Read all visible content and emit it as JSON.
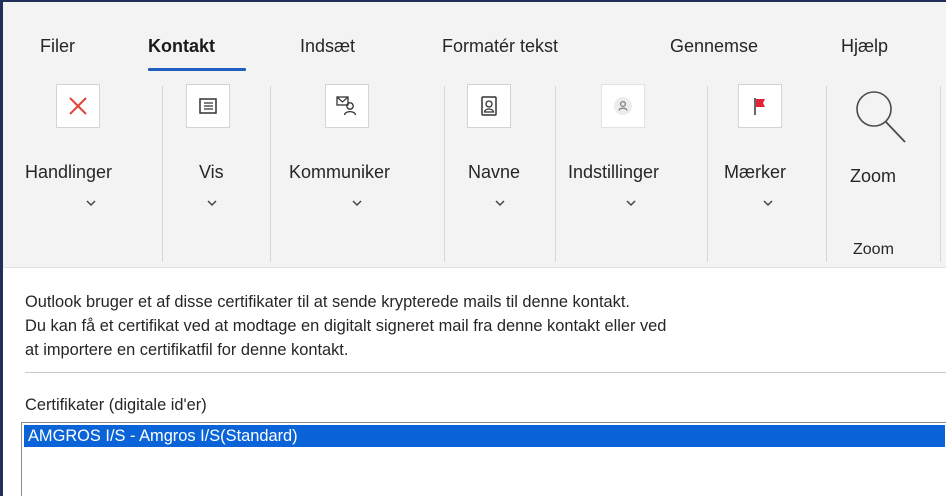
{
  "tabs": [
    {
      "label": "Filer"
    },
    {
      "label": "Kontakt"
    },
    {
      "label": "Indsæt"
    },
    {
      "label": "Formatér tekst"
    },
    {
      "label": "Gennemse"
    },
    {
      "label": "Hjælp"
    }
  ],
  "active_tab": "Kontakt",
  "groups": {
    "handlinger": {
      "label": "Handlinger",
      "icon": "close-x-icon"
    },
    "vis": {
      "label": "Vis",
      "icon": "view-icon"
    },
    "kommuniker": {
      "label": "Kommuniker",
      "icon": "communicate-icon"
    },
    "navne": {
      "label": "Navne",
      "icon": "address-book-icon"
    },
    "indstillinger": {
      "label": "Indstillinger",
      "icon": "contact-options-icon"
    },
    "maerker": {
      "label": "Mærker",
      "icon": "red-flag-icon"
    },
    "zoom": {
      "label": "Zoom",
      "group_label": "Zoom",
      "icon": "magnifier-icon"
    }
  },
  "info_lines": [
    "Outlook bruger et af disse certifikater til at sende krypterede mails til denne kontakt.",
    "Du kan få et certifikat ved at modtage en digitalt signeret mail fra denne kontakt eller ved",
    "at importere en certifikatfil for denne kontakt."
  ],
  "certificates": {
    "label": "Certifikater (digitale id'er)",
    "items": [
      "AMGROS I/S - Amgros I/S(Standard)"
    ]
  },
  "colors": {
    "accent": "#1f5fbf",
    "selection": "#0a64d8",
    "flag": "#e0253a",
    "close_x": "#e0443a",
    "frame": "#1f2f55"
  }
}
